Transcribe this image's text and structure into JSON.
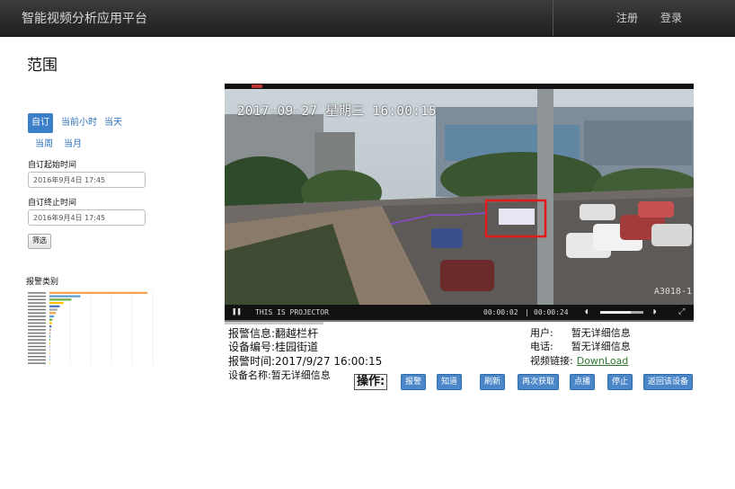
{
  "app": {
    "title": "智能视频分析应用平台",
    "nav": {
      "register": "注册",
      "login": "登录"
    }
  },
  "sidebar": {
    "scope_title": "范围",
    "range_buttons": [
      "自订",
      "当前小时",
      "当天",
      "当周",
      "当月"
    ],
    "start_label": "自订起始时间",
    "start_value": "2016年9月4日 17:45",
    "end_label": "自订终止时间",
    "end_value": "2016年9月4日 17:45",
    "filter_label": "筛选",
    "category_title": "报警类别"
  },
  "mini_chart_data": {
    "type": "bar",
    "orientation": "horizontal",
    "bar_values": [
      380,
      120,
      85,
      55,
      40,
      30,
      25,
      18,
      12,
      10,
      8,
      6,
      5,
      4,
      3,
      3,
      2,
      2,
      2,
      1,
      1,
      1
    ],
    "bar_colors": [
      "#f2a54a",
      "#5b9bd5",
      "#70ad47",
      "#ffc000",
      "#4472c4",
      "#a5a5a5"
    ],
    "xlim": [
      0,
      400
    ]
  },
  "player": {
    "osd_time": "2017-09-27 星期三 16:00:15",
    "camera_id": "A3018-1",
    "caption": "THIS IS PROJECTOR",
    "current_time": "00:00:02",
    "total_time": "00:00:24",
    "volume": 0.7
  },
  "info": {
    "alarm_info_label": "报警信息:",
    "alarm_info_value": "翻越栏杆",
    "device_no_label": "设备编号:",
    "device_no_value": "桂园街道",
    "alarm_time_label": "报警时间:",
    "alarm_time_value": "2017/9/27 16:00:15",
    "device_name_label": "设备名称:",
    "device_name_value": "暂无详细信息",
    "user_label": "用户:",
    "user_value": "暂无详细信息",
    "phone_label": "电话:",
    "phone_value": "暂无详细信息",
    "video_label": "视频链接:",
    "video_link": "DownLoad"
  },
  "operations": {
    "label": "操作:",
    "buttons": [
      "报警",
      "知道",
      "刷新",
      "再次获取",
      "点播",
      "停止",
      "返回该设备"
    ]
  }
}
